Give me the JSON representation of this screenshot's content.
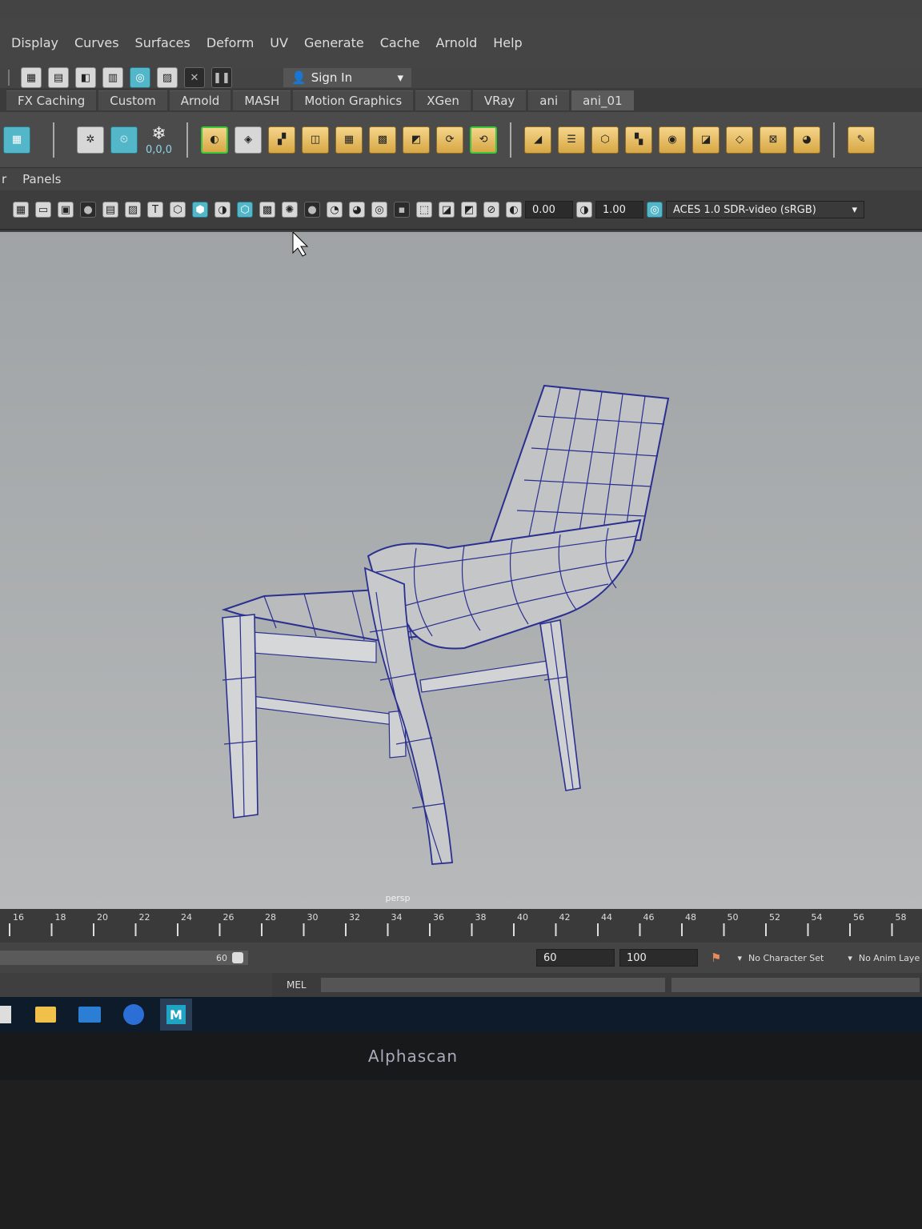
{
  "menu": [
    "Display",
    "Curves",
    "Surfaces",
    "Deform",
    "UV",
    "Generate",
    "Cache",
    "Arnold",
    "Help"
  ],
  "status": {
    "sign_in": "Sign In"
  },
  "shelf_tabs": [
    "FX Caching",
    "Custom",
    "Arnold",
    "MASH",
    "Motion Graphics",
    "XGen",
    "VRay",
    "ani",
    "ani_01"
  ],
  "shelf_text": {
    "coords": "0,0,0"
  },
  "panel_menu": {
    "left": "r",
    "panels": "Panels"
  },
  "panel_tools": {
    "exposure": "0.00",
    "gamma": "1.00",
    "colorspace": "ACES 1.0 SDR-video (sRGB)"
  },
  "viewport": {
    "camera": "persp"
  },
  "timeline": {
    "ticks": [
      "16",
      "18",
      "20",
      "22",
      "24",
      "26",
      "28",
      "30",
      "32",
      "34",
      "36",
      "38",
      "40",
      "42",
      "44",
      "46",
      "48",
      "50",
      "52",
      "54",
      "56",
      "58"
    ]
  },
  "range": {
    "slider_value": "60",
    "end": "60",
    "max": "100",
    "character_set": "No Character Set",
    "anim_layer": "No Anim Laye"
  },
  "cmdline": {
    "label": "MEL"
  },
  "taskbar": {
    "maya": "M"
  },
  "monitor": {
    "brand": "Alphascan"
  },
  "colors": {
    "accent": "#53b6c9",
    "shelf_gold": "#e6bb5c",
    "wire": "#2b2f8f"
  }
}
